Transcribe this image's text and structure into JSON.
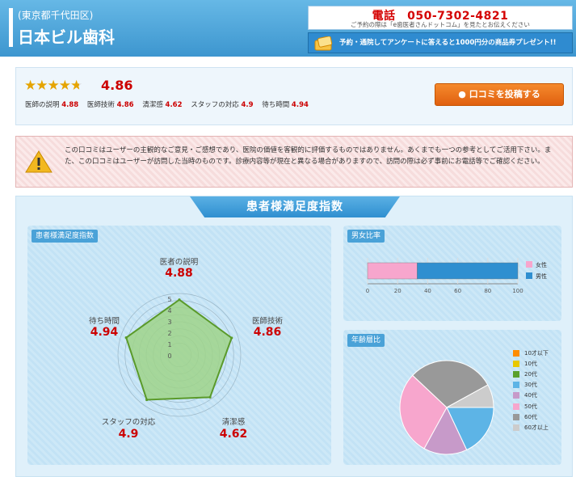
{
  "header": {
    "area": "(東京都千代田区)",
    "clinic_name": "日本ビル歯科",
    "phone_label": "電話　050-7302-4821",
    "phone_note": "ご予約の際は「e歯医者さんドットコム」を見たとお伝えください",
    "promo": "予約・通院してアンケートに答えると1000円分の商品券プレゼント!!"
  },
  "rating": {
    "stars": 4.86,
    "overall": "4.86",
    "items": [
      {
        "label": "医師の説明",
        "value": "4.88"
      },
      {
        "label": "医師技術",
        "value": "4.86"
      },
      {
        "label": "清潔感",
        "value": "4.62"
      },
      {
        "label": "スタッフの対応",
        "value": "4.9"
      },
      {
        "label": "待ち時間",
        "value": "4.94"
      }
    ],
    "post_button": "口コミを投稿する"
  },
  "warning": {
    "text": "この口コミはユーザーの主観的なご意見・ご感想であり、医院の価値を客観的に評価するものではありません。あくまでも一つの参考としてご活用下さい。また、この口コミはユーザーが訪問した当時のものです。診療内容等が現在と異なる場合がありますので、訪問の際は必ず事前にお電話等でご確認ください。"
  },
  "satisfaction": {
    "title": "患者様満足度指数",
    "radar_tag": "患者様満足度指数",
    "gender_tag": "男女比率",
    "age_tag": "年齢層比"
  },
  "chart_data": [
    {
      "type": "radar",
      "max": 5,
      "ticks": [
        "5",
        "4",
        "3",
        "2",
        "1",
        "0"
      ],
      "axes": [
        {
          "label": "医者の説明",
          "value": 4.88,
          "display": "4.88"
        },
        {
          "label": "医師技術",
          "value": 4.86,
          "display": "4.86"
        },
        {
          "label": "清潔感",
          "value": 4.62,
          "display": "4.62"
        },
        {
          "label": "スタッフの対応",
          "value": 4.9,
          "display": "4.9"
        },
        {
          "label": "待ち時間",
          "value": 4.94,
          "display": "4.94"
        }
      ],
      "colors": {
        "fill": "#9fd38a",
        "stroke": "#5a9a2a"
      }
    },
    {
      "type": "bar",
      "orientation": "horizontal",
      "stacked": true,
      "xlim": [
        0,
        100
      ],
      "xticks": [
        "0",
        "20",
        "40",
        "60",
        "80",
        "100"
      ],
      "series": [
        {
          "name": "女性",
          "value": 33,
          "color": "#f7a6cd"
        },
        {
          "name": "男性",
          "value": 67,
          "color": "#2f8fd0"
        }
      ]
    },
    {
      "type": "pie",
      "legend_position": "right",
      "series": [
        {
          "name": "10才以下",
          "value": 0,
          "color": "#ff8c00"
        },
        {
          "name": "10代",
          "value": 0,
          "color": "#e8c800"
        },
        {
          "name": "20代",
          "value": 0,
          "color": "#5aa02c"
        },
        {
          "name": "30代",
          "value": 18,
          "color": "#5db4e6"
        },
        {
          "name": "40代",
          "value": 15,
          "color": "#c79ac9"
        },
        {
          "name": "50代",
          "value": 29,
          "color": "#f7a6cd"
        },
        {
          "name": "60代",
          "value": 30,
          "color": "#999999"
        },
        {
          "name": "60才以上",
          "value": 8,
          "color": "#cccccc"
        }
      ]
    }
  ]
}
